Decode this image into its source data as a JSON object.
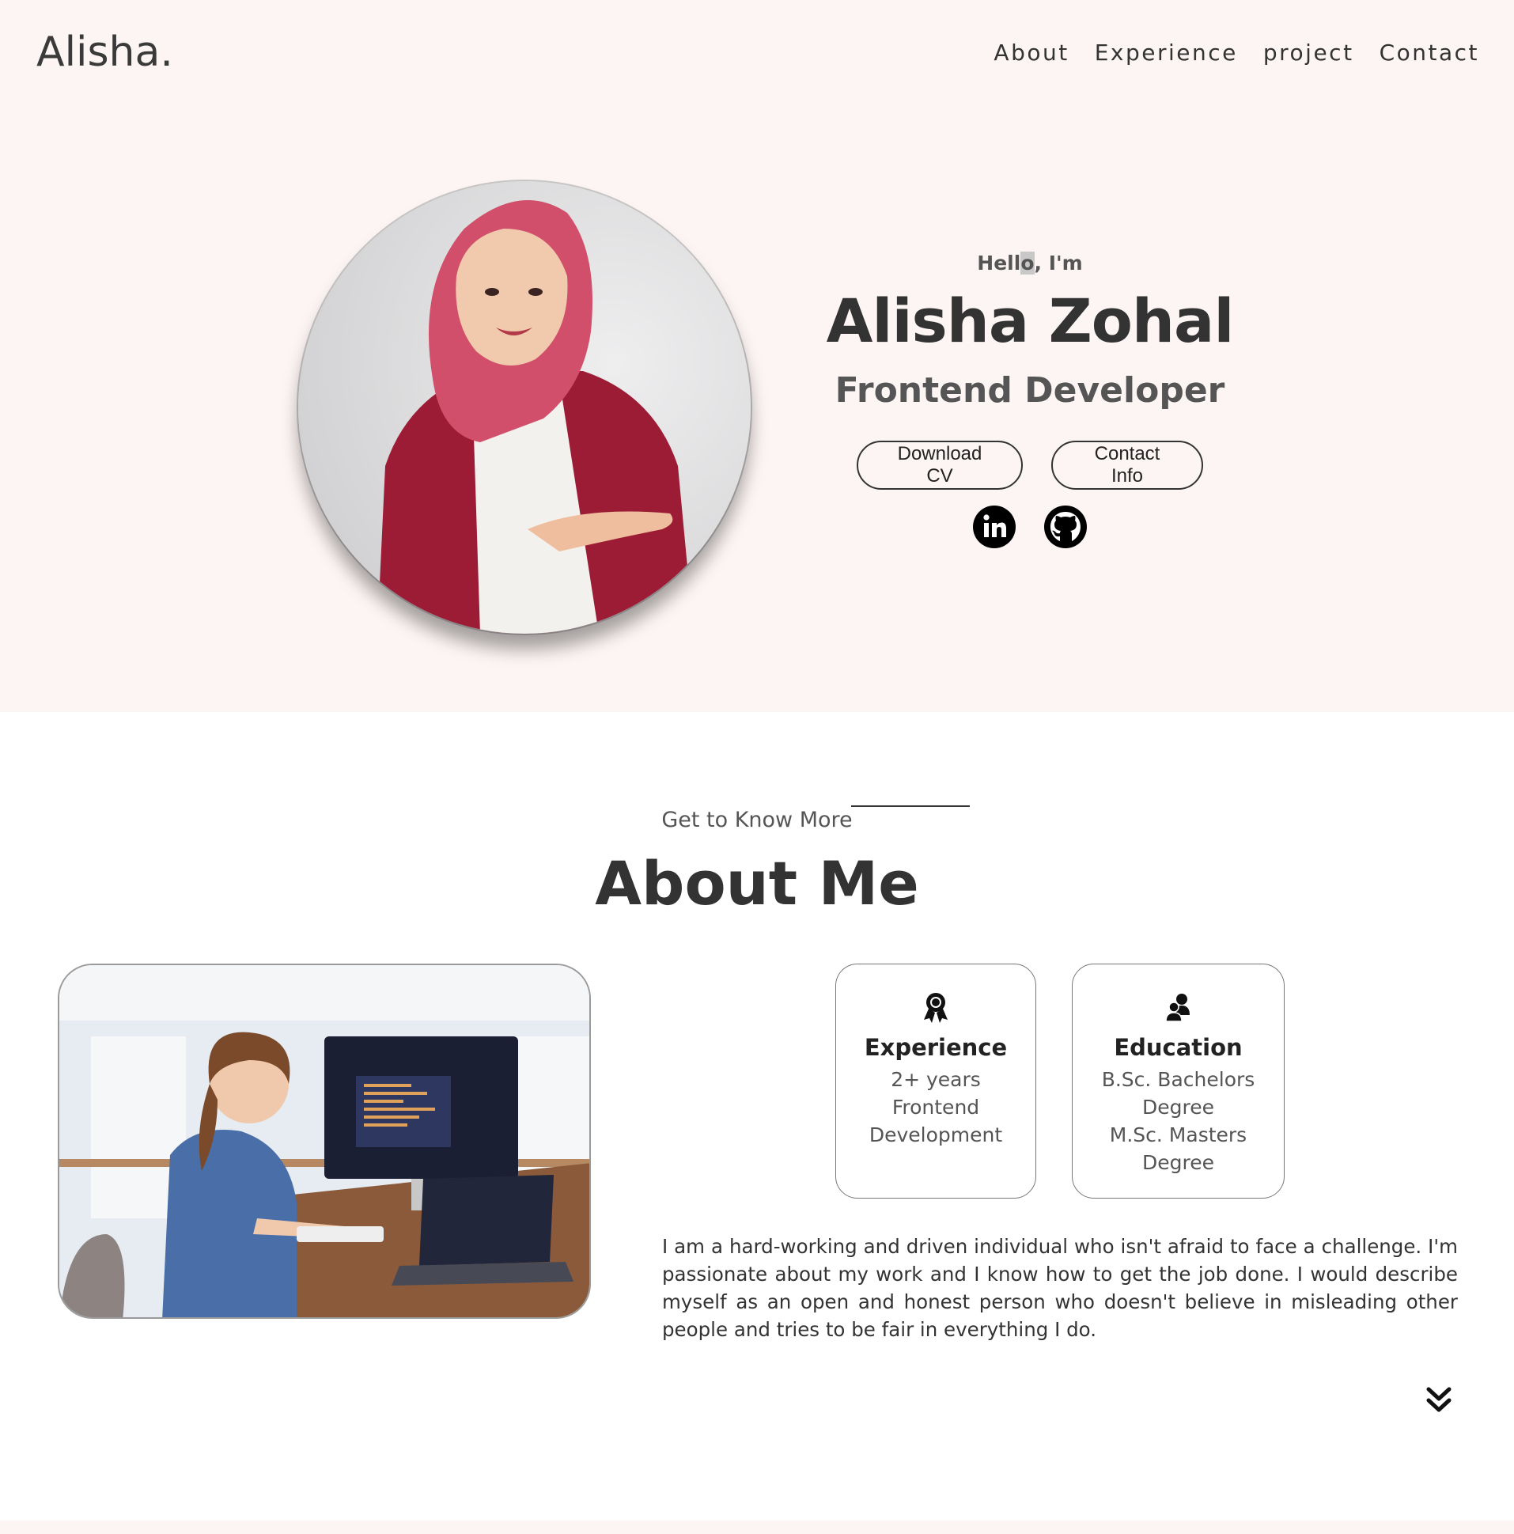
{
  "header": {
    "logo": "Alisha.",
    "nav": [
      {
        "label": "About"
      },
      {
        "label": "Experience"
      },
      {
        "label": "project"
      },
      {
        "label": "Contact"
      }
    ]
  },
  "hero": {
    "greeting_pre": "Hell",
    "greeting_cursor": "o",
    "greeting_post": ", I'm",
    "name": "Alisha Zohal",
    "role": "Frontend Developer",
    "download_cv": "Download CV",
    "contact_info": "Contact Info",
    "social_icons": [
      "linkedin-icon",
      "github-icon"
    ]
  },
  "about": {
    "subtitle": "Get to Know More",
    "title": "About Me",
    "cards": {
      "experience": {
        "icon": "award-icon",
        "title": "Experience",
        "lines": [
          "2+ years",
          "Frontend",
          "Development"
        ]
      },
      "education": {
        "icon": "users-icon",
        "title": "Education",
        "lines": [
          "B.Sc. Bachelors",
          "Degree",
          "M.Sc. Masters",
          "Degree"
        ]
      }
    },
    "bio": "I am a hard-working and driven individual who isn't afraid to face a challenge. I'm passionate about my work and I know how to get the job done. I would describe myself as an open and honest person who doesn't believe in misleading other people and tries to be fair in everything I do."
  },
  "colors": {
    "hero_bg": "#fdf5f3",
    "text": "#333333",
    "muted": "#555555"
  }
}
